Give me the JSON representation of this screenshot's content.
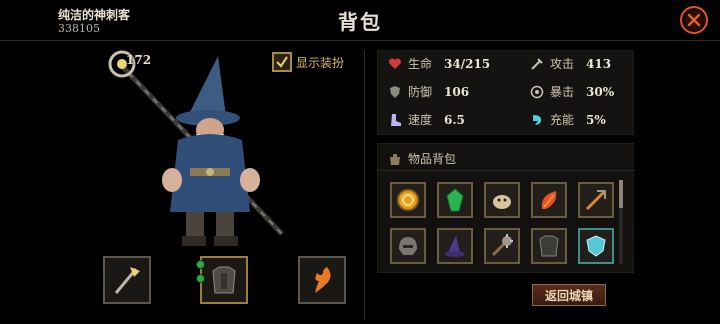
{
  "player": {
    "name": "纯洁的神刺客",
    "id": "338105",
    "level": "172"
  },
  "title": "背包",
  "toggle": {
    "label": "显示装扮",
    "checked": true
  },
  "stats": [
    {
      "label": "生命",
      "value": "34/215",
      "icon": "heart-icon"
    },
    {
      "label": "攻击",
      "value": "413",
      "icon": "sword-icon"
    },
    {
      "label": "防御",
      "value": "106",
      "icon": "shield-icon"
    },
    {
      "label": "暴击",
      "value": "30%",
      "icon": "target-icon"
    },
    {
      "label": "速度",
      "value": "6.5",
      "icon": "boot-icon"
    },
    {
      "label": "充能",
      "value": "5%",
      "icon": "charge-icon"
    }
  ],
  "bag": {
    "title": "物品背包"
  },
  "items": [
    {
      "name": "gold-coin-icon"
    },
    {
      "name": "green-gem-icon"
    },
    {
      "name": "creature-icon"
    },
    {
      "name": "fire-leaf-icon"
    },
    {
      "name": "crossbow-icon"
    },
    {
      "name": "helmet-icon"
    },
    {
      "name": "wizard-hat-icon"
    },
    {
      "name": "spiked-mace-icon"
    },
    {
      "name": "dark-armor-icon"
    },
    {
      "name": "crystal-shield-icon"
    }
  ],
  "return_label": "返回城镇",
  "colors": {
    "accent": "#d8542c",
    "gold": "#d8b864",
    "health": "#d23a3a"
  }
}
